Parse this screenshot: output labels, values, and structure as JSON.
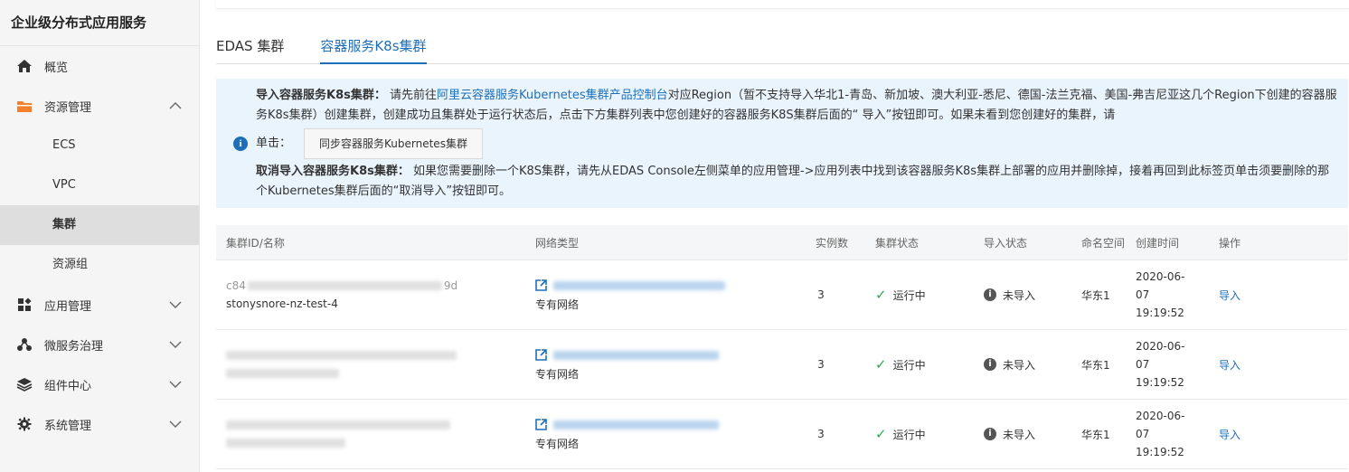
{
  "sidebar": {
    "title": "企业级分布式应用服务",
    "items": [
      {
        "label": "概览",
        "icon": "home-icon"
      },
      {
        "label": "资源管理",
        "icon": "folder-icon",
        "expanded": true,
        "children": [
          "ECS",
          "VPC",
          "集群",
          "资源组"
        ],
        "active_child": "集群"
      },
      {
        "label": "应用管理",
        "icon": "apps-icon"
      },
      {
        "label": "微服务治理",
        "icon": "network-icon"
      },
      {
        "label": "组件中心",
        "icon": "layers-icon"
      },
      {
        "label": "系统管理",
        "icon": "gear-icon"
      }
    ]
  },
  "tabs": [
    {
      "label": "EDAS 集群",
      "active": false
    },
    {
      "label": "容器服务K8s集群",
      "active": true
    }
  ],
  "notice": {
    "import_title": "导入容器服务K8s集群：",
    "import_text_pre": "请先前往",
    "import_link": "阿里云容器服务Kubernetes集群产品控制台",
    "import_text_post": "对应Region（暂不支持导入华北1-青岛、新加坡、澳大利亚-悉尼、德国-法兰克福、美国-弗吉尼亚这几个Region下创建的容器服务K8s集群）创建集群，创建成功且集群处于运行状态后，点击下方集群列表中您创建好的容器服务K8S集群后面的“ 导入”按钮即可。如果未看到您创建好的集群，请",
    "click_label": "单击：",
    "sync_button": "同步容器服务Kubernetes集群",
    "cancel_title": "取消导入容器服务K8s集群：",
    "cancel_text": "如果您需要删除一个K8S集群，请先从EDAS Console左侧菜单的应用管理->应用列表中找到该容器服务K8s集群上部署的应用并删除掉，接着再回到此标签页单击须要删除的那个Kubernetes集群后面的“取消导入”按钮即可。"
  },
  "table": {
    "headers": [
      "集群ID/名称",
      "网络类型",
      "实例数",
      "集群状态",
      "导入状态",
      "命名空间",
      "创建时间",
      "操作"
    ],
    "rows": [
      {
        "id_visible": "c84",
        "id_tail": "9d",
        "name": "stonysnore-nz-test-4",
        "network": "专有网络",
        "instances": "3",
        "status": "运行中",
        "import_status": "未导入",
        "namespace": "华东1",
        "date_line1": "2020-06-",
        "date_line2": "07",
        "date_line3": "19:19:52",
        "action": "导入"
      },
      {
        "id_visible": "",
        "id_tail": "",
        "name": "",
        "network": "专有网络",
        "instances": "3",
        "status": "运行中",
        "import_status": "未导入",
        "namespace": "华东1",
        "date_line1": "2020-06-",
        "date_line2": "07",
        "date_line3": "19:19:52",
        "action": "导入"
      },
      {
        "id_visible": "",
        "id_tail": "",
        "name": "",
        "network": "专有网络",
        "instances": "3",
        "status": "运行中",
        "import_status": "未导入",
        "namespace": "华东1",
        "date_line1": "2020-06-",
        "date_line2": "07",
        "date_line3": "19:19:52",
        "action": "导入"
      }
    ]
  },
  "colors": {
    "accent": "#1e6fb8",
    "success": "#2fa84f",
    "notice_bg": "#eaf4fd"
  }
}
